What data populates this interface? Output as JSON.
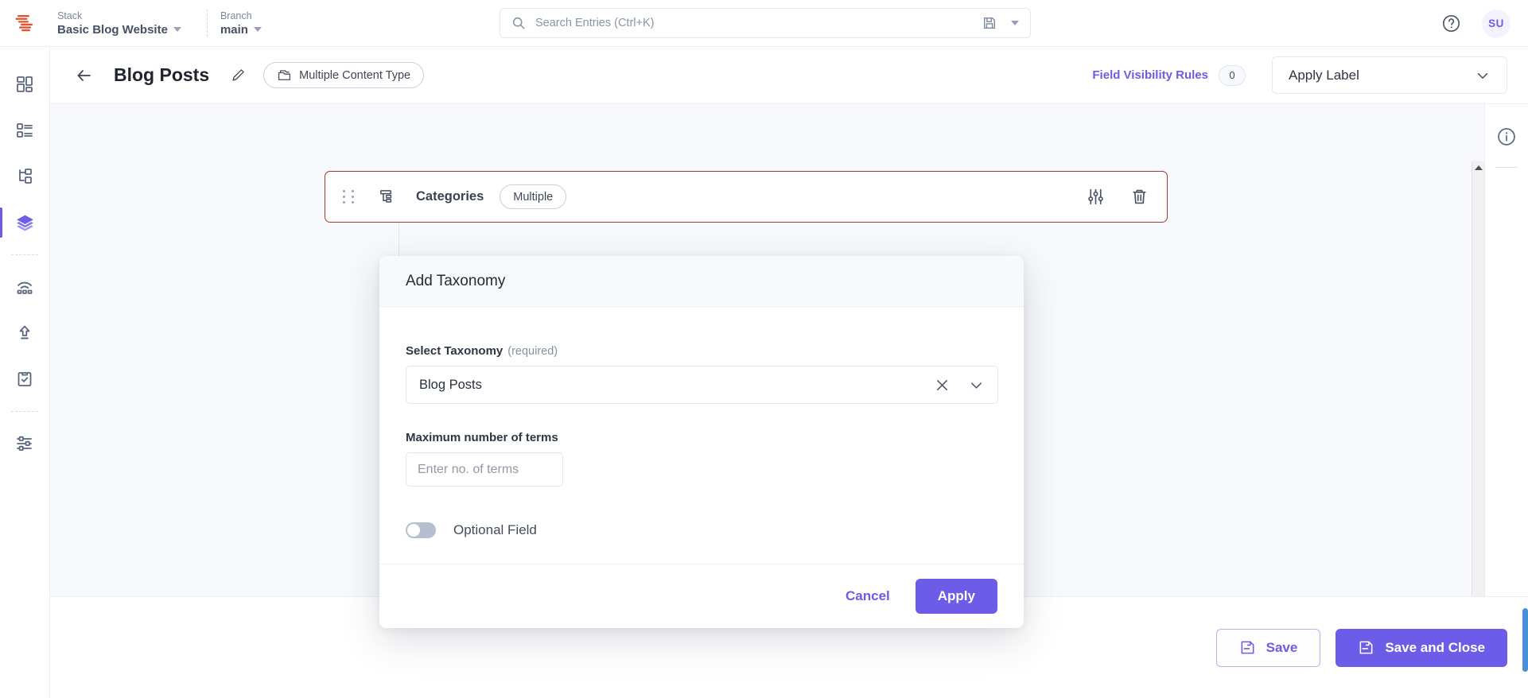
{
  "topbar": {
    "logo_icon": "contentstack-logo-icon",
    "stack": {
      "label": "Stack",
      "value": "Basic Blog Website"
    },
    "branch": {
      "label": "Branch",
      "value": "main"
    },
    "search": {
      "placeholder": "Search Entries (Ctrl+K)",
      "icon": "search-icon",
      "save_icon": "floppy-disk-icon",
      "caret_icon": "caret-down-icon"
    },
    "notifications_icon": "bell-icon",
    "help_icon": "question-circle-icon",
    "avatar_initials": "SU"
  },
  "rail": {
    "items": [
      {
        "name": "dashboard",
        "icon": "dashboard-grid-icon",
        "active": false
      },
      {
        "name": "entries",
        "icon": "list-entries-icon",
        "active": false
      },
      {
        "name": "assets",
        "icon": "hierarchy-icon",
        "active": false
      },
      {
        "name": "content-models",
        "icon": "layers-stack-icon",
        "active": true
      },
      {
        "name": "live-preview",
        "icon": "broadcast-icon",
        "active": false
      },
      {
        "name": "publish-queue",
        "icon": "upload-arrow-icon",
        "active": false
      },
      {
        "name": "releases",
        "icon": "clipboard-check-icon",
        "active": false
      },
      {
        "name": "settings",
        "icon": "sliders-settings-icon",
        "active": false
      }
    ]
  },
  "page_head": {
    "back_icon": "arrow-left-icon",
    "title": "Blog Posts",
    "edit_icon": "pencil-icon",
    "content_type_pill": {
      "label": "Multiple Content Type",
      "icon": "content-type-icon"
    },
    "field_visibility_rules": {
      "label": "Field Visibility Rules",
      "count": "0"
    },
    "apply_label": {
      "value": "Apply Label",
      "caret_icon": "chevron-down-icon"
    }
  },
  "canvas": {
    "field_row": {
      "drag_handle_icon": "drag-dots-icon",
      "type_icon": "taxonomy-icon",
      "name": "Categories",
      "badge": "Multiple",
      "settings_icon": "sliders-icon",
      "delete_icon": "trash-icon"
    },
    "add_taxonomy_button": {
      "label": "Add Taxonomy",
      "icon": "plus-icon"
    }
  },
  "right_panel": {
    "info_icon": "info-circle-icon"
  },
  "modal": {
    "title": "Add Taxonomy",
    "select_taxonomy": {
      "label": "Select Taxonomy",
      "required_note": "(required)",
      "value": "Blog Posts",
      "clear_icon": "close-x-icon",
      "caret_icon": "chevron-down-icon"
    },
    "max_terms": {
      "label": "Maximum number of terms",
      "placeholder": "Enter no. of terms",
      "value": ""
    },
    "optional_field": {
      "label": "Optional Field",
      "enabled": false
    },
    "cancel_label": "Cancel",
    "apply_label": "Apply"
  },
  "bottombar": {
    "save": {
      "label": "Save",
      "icon": "save-floppy-icon"
    },
    "save_and_close": {
      "label": "Save and Close",
      "icon": "save-floppy-icon"
    }
  },
  "colors": {
    "accent": "#6c5ce7",
    "field_highlight": "#a33a2a",
    "canvas_bg": "#f7f9fc",
    "text": "#2f3644"
  }
}
